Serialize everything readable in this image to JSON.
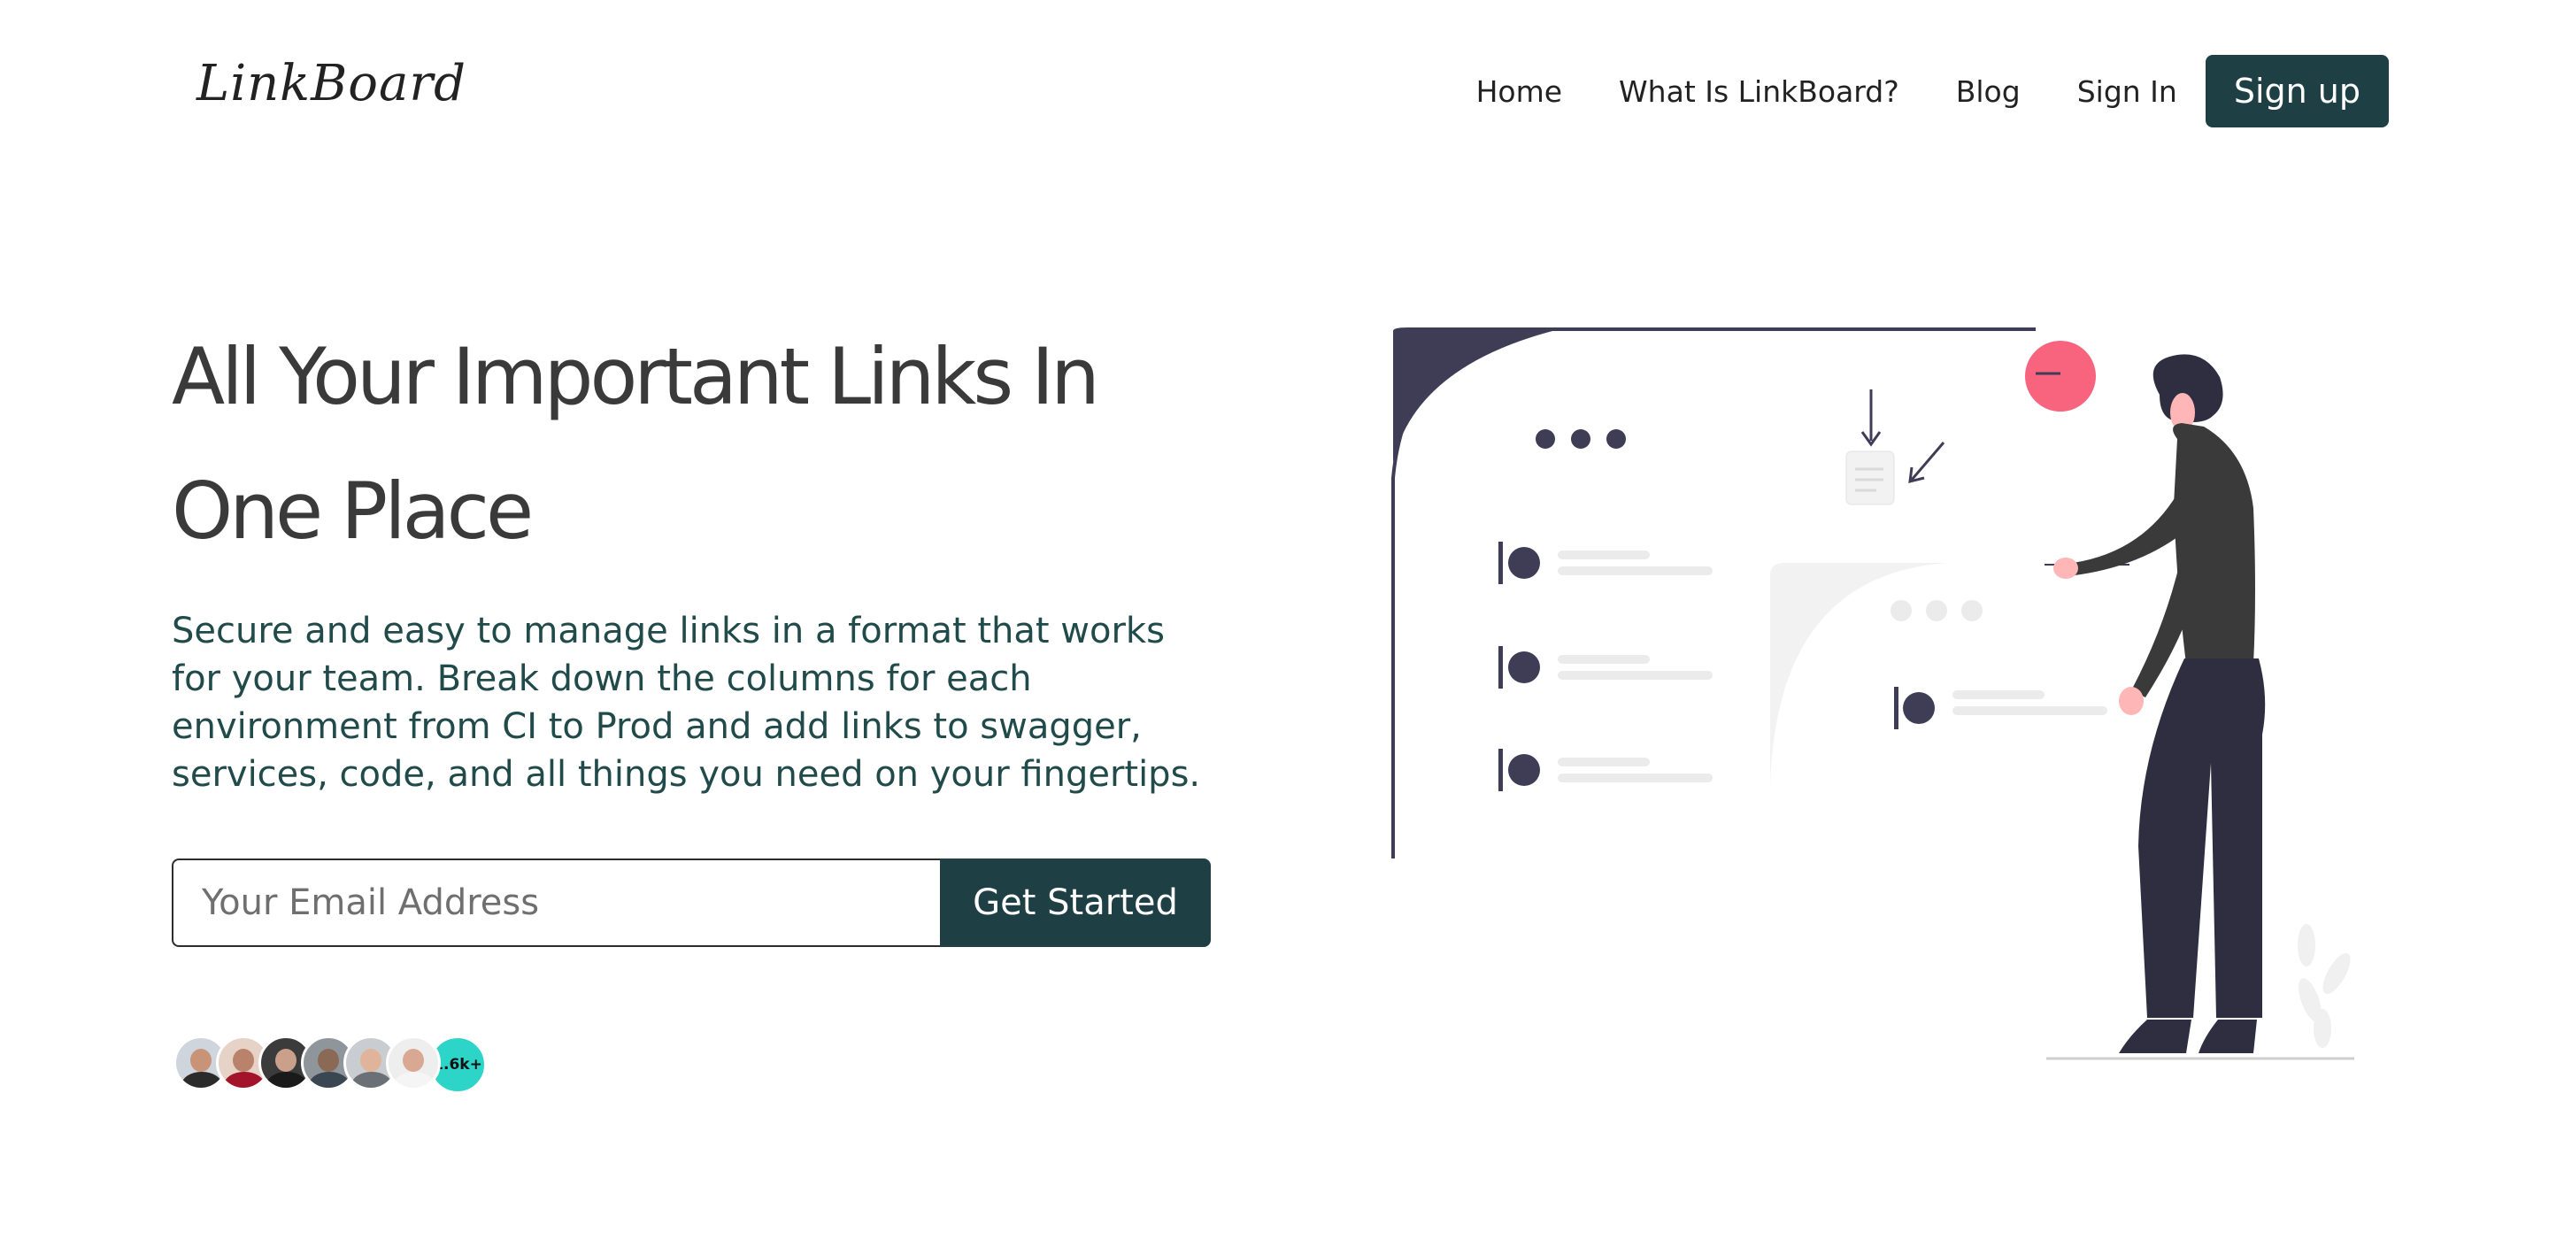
{
  "brand": {
    "logo": "LinkBoard"
  },
  "nav": {
    "items": [
      "Home",
      "What Is LinkBoard?",
      "Blog",
      "Sign In"
    ],
    "signup": "Sign up"
  },
  "hero": {
    "headline_lines": [
      "All Your Important Links In",
      "One Place"
    ],
    "description_lines": [
      "Secure and easy to manage links in a format that works",
      "for your team. Break down the columns for each",
      "environment from CI to Prod and add links to swagger,",
      "services, code, and all things you need on your fingertips."
    ]
  },
  "form": {
    "email_placeholder": "Your Email Address",
    "cta_label": "Get Started"
  },
  "social_proof": {
    "avatar_count_shown": 6,
    "count_label": "1.6k+"
  },
  "colors": {
    "brand_dark": "#1e4045",
    "accent_teal": "#2dd4c8",
    "accent_pink": "#f8637e",
    "illustration_dark": "#3f3d56"
  },
  "icons": {
    "illustration": "person-presenting-dashboard-illustration"
  }
}
